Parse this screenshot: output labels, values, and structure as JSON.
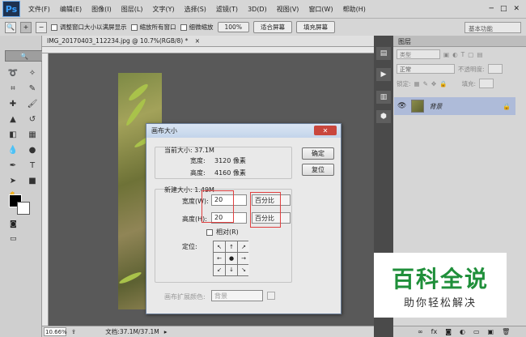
{
  "menubar": {
    "logo": "Ps",
    "items": [
      "文件(F)",
      "编辑(E)",
      "图像(I)",
      "图层(L)",
      "文字(Y)",
      "选择(S)",
      "滤镜(T)",
      "3D(D)",
      "视图(V)",
      "窗口(W)",
      "帮助(H)"
    ]
  },
  "optionsbar": {
    "checkbox1": "调整窗口大小以满屏显示",
    "checkbox2": "缩放所有窗口",
    "checkbox3": "细微缩放",
    "zoom_button": "100%",
    "fit_button": "适合屏幕",
    "fill_button": "填充屏幕",
    "workspace": "基本功能"
  },
  "document": {
    "tab_title": "IMG_20170403_112234.jpg @ 10.7%(RGB/8) *"
  },
  "status": {
    "zoom": "10.66%",
    "doc_info": "文档:37.1M/37.1M"
  },
  "layers_panel": {
    "tab": "图层",
    "kind_filter": "类型",
    "blend_mode": "正常",
    "opacity_label": "不透明度:",
    "lock_label": "锁定:",
    "fill_label": "填充:",
    "layer_name": "背景"
  },
  "dialog": {
    "title": "画布大小",
    "current_size_label": "当前大小: 37.1M",
    "cur_width_label": "宽度:",
    "cur_width_value": "3120 像素",
    "cur_height_label": "高度:",
    "cur_height_value": "4160 像素",
    "new_size_label": "新建大小: 1.49M",
    "width_label": "宽度(W):",
    "width_value": "20",
    "height_label": "高度(H):",
    "height_value": "20",
    "unit_width": "百分比",
    "unit_height": "百分比",
    "relative_label": "相对(R)",
    "anchor_label": "定位:",
    "ext_color_label": "画布扩展颜色:",
    "ext_color_value": "背景",
    "ok_button": "确定",
    "reset_button": "复位"
  },
  "watermark": {
    "line1": "百科全说",
    "line2": "助你轻松解决"
  }
}
